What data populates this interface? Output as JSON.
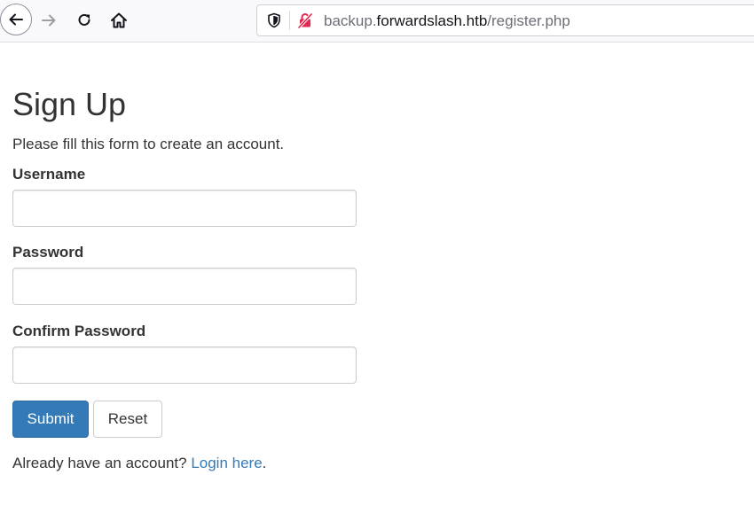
{
  "browser": {
    "url_prefix": "backup.",
    "url_host": "forwardslash.htb",
    "url_path": "/register.php"
  },
  "page": {
    "title": "Sign Up",
    "intro": "Please fill this form to create an account.",
    "fields": {
      "username_label": "Username",
      "username_value": "",
      "password_label": "Password",
      "password_value": "",
      "confirm_label": "Confirm Password",
      "confirm_value": ""
    },
    "buttons": {
      "submit_label": "Submit",
      "reset_label": "Reset"
    },
    "footer": {
      "prompt": "Already have an account? ",
      "link_text": "Login here",
      "suffix": "."
    }
  },
  "colors": {
    "primary": "#337ab7",
    "text": "#333333",
    "border": "#cccccc",
    "insecure_icon": "#e22850"
  },
  "icons": [
    "back-arrow-icon",
    "forward-arrow-icon",
    "reload-icon",
    "home-icon",
    "shield-icon",
    "insecure-lock-icon"
  ]
}
